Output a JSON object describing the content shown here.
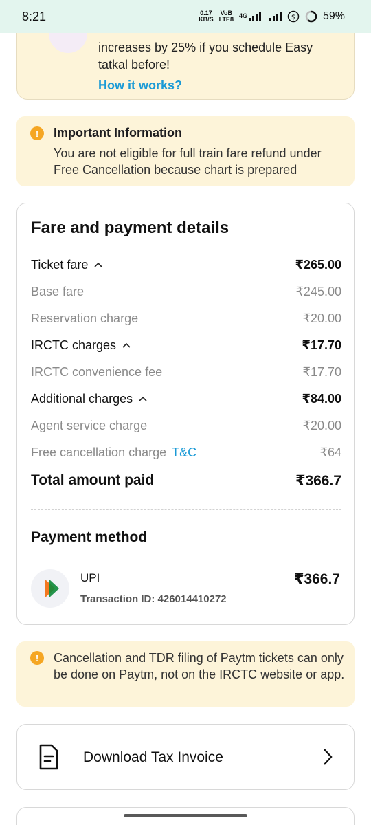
{
  "status_bar": {
    "time": "8:21",
    "speed_value": "0.17",
    "speed_unit": "KB/S",
    "volte_top": "VoB",
    "volte_bottom": "LTE8",
    "network": "4G",
    "battery": "59%"
  },
  "tatkal_card": {
    "text": "increases by 25% if you schedule Easy tatkal before!",
    "link": "How it works?"
  },
  "important_info": {
    "title": "Important Information",
    "text": "You are not eligible for full train fare refund under Free Cancellation because chart is prepared"
  },
  "fare": {
    "title": "Fare and payment details",
    "rows": [
      {
        "label": "Ticket fare",
        "amount": "₹265.00",
        "kind": "main",
        "expandable": true
      },
      {
        "label": "Base fare",
        "amount": "₹245.00",
        "kind": "sub"
      },
      {
        "label": "Reservation charge",
        "amount": "₹20.00",
        "kind": "sub"
      },
      {
        "label": "IRCTC charges",
        "amount": "₹17.70",
        "kind": "main",
        "expandable": true
      },
      {
        "label": "IRCTC convenience fee",
        "amount": "₹17.70",
        "kind": "sub"
      },
      {
        "label": "Additional charges",
        "amount": "₹84.00",
        "kind": "main",
        "expandable": true
      },
      {
        "label": "Agent service charge",
        "amount": "₹20.00",
        "kind": "sub"
      },
      {
        "label": "Free cancellation charge",
        "link": "T&C",
        "amount": "₹64",
        "kind": "sub"
      }
    ],
    "total_label": "Total amount paid",
    "total_amount": "₹366.7",
    "payment_method_title": "Payment method",
    "payment": {
      "method": "UPI",
      "transaction": "Transaction ID: 426014410272",
      "amount": "₹366.7"
    }
  },
  "cancellation_notice": {
    "text": "Cancellation and TDR filing of Paytm tickets can only be done on Paytm, not on the IRCTC website or app."
  },
  "download": {
    "label": "Download Tax Invoice"
  },
  "colors": {
    "info_bg": "#fdf4d9",
    "accent_link": "#1a9ad6",
    "info_icon": "#f5a623",
    "status_bar_bg": "#e3f5ee"
  }
}
